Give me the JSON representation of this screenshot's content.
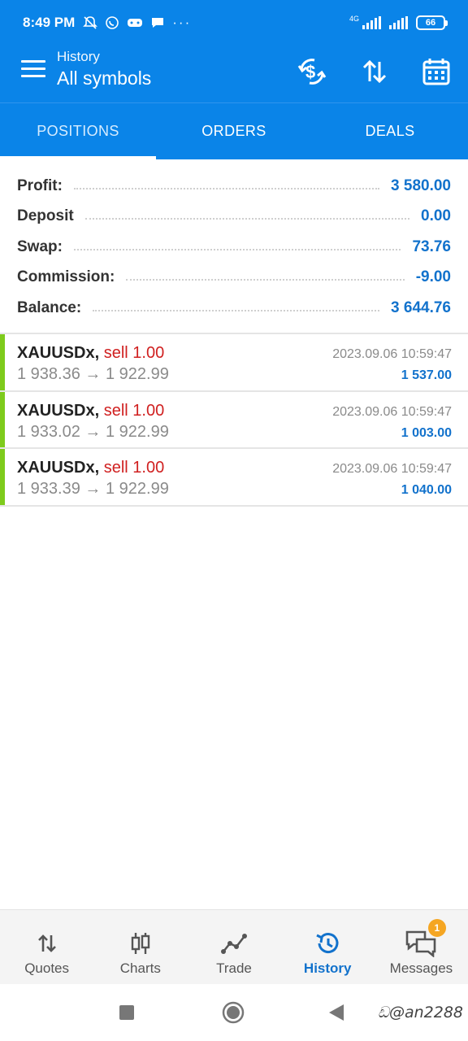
{
  "status_bar": {
    "time": "8:49 PM",
    "network": "4G",
    "battery": "66"
  },
  "app_bar": {
    "subtitle": "History",
    "title": "All symbols",
    "actions": [
      "currency-exchange-icon",
      "sort-icon",
      "calendar-icon"
    ]
  },
  "tabs": [
    {
      "label": "POSITIONS",
      "active": true
    },
    {
      "label": "ORDERS",
      "active": false
    },
    {
      "label": "DEALS",
      "active": false
    }
  ],
  "summary": [
    {
      "label": "Profit:",
      "value": "3 580.00"
    },
    {
      "label": "Deposit",
      "value": "0.00"
    },
    {
      "label": "Swap:",
      "value": "73.76"
    },
    {
      "label": "Commission:",
      "value": "-9.00"
    },
    {
      "label": "Balance:",
      "value": "3 644.76"
    }
  ],
  "deals": [
    {
      "symbol": "XAUUSDx,",
      "side": "sell 1.00",
      "prices": "1 938.36 → 1 922.99",
      "time": "2023.09.06 10:59:47",
      "profit": "1 537.00"
    },
    {
      "symbol": "XAUUSDx,",
      "side": "sell 1.00",
      "prices": "1 933.02 → 1 922.99",
      "time": "2023.09.06 10:59:47",
      "profit": "1 003.00"
    },
    {
      "symbol": "XAUUSDx,",
      "side": "sell 1.00",
      "prices": "1 933.39 → 1 922.99",
      "time": "2023.09.06 10:59:47",
      "profit": "1 040.00"
    }
  ],
  "bottom_nav": [
    {
      "label": "Quotes",
      "icon": "quotes-icon",
      "active": false
    },
    {
      "label": "Charts",
      "icon": "charts-icon",
      "active": false
    },
    {
      "label": "Trade",
      "icon": "trade-icon",
      "active": false
    },
    {
      "label": "History",
      "icon": "history-icon",
      "active": true
    },
    {
      "label": "Messages",
      "icon": "messages-icon",
      "active": false,
      "badge": "1"
    }
  ],
  "watermark": "ඩ@an2288",
  "colors": {
    "primary": "#0a84e8",
    "value_blue": "#1272cc",
    "sell_red": "#d02020",
    "deal_accent": "#7ecb1c",
    "badge": "#f5a623"
  }
}
